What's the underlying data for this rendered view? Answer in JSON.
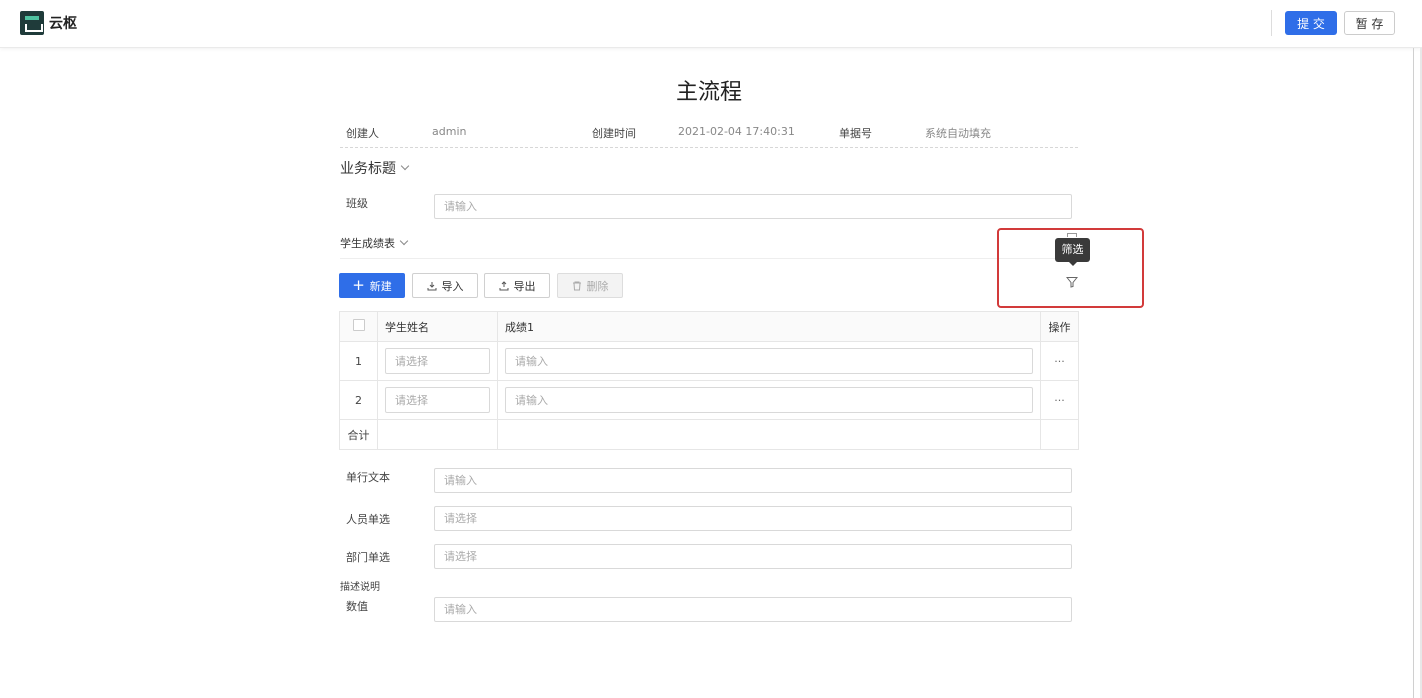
{
  "header": {
    "app_name": "云枢",
    "submit_label": "提 交",
    "draft_label": "暂 存"
  },
  "form": {
    "title": "主流程",
    "meta": {
      "creator_label": "创建人",
      "creator_value": "admin",
      "created_time_label": "创建时间",
      "created_time_value": "2021-02-04 17:40:31",
      "doc_no_label": "单据号",
      "doc_no_value": "系统自动填充"
    },
    "business_title_section": "业务标题",
    "class_field": {
      "label": "班级",
      "placeholder": "请输入"
    },
    "subtable": {
      "title": "学生成绩表",
      "toolbar": {
        "new_label": "新建",
        "import_label": "导入",
        "export_label": "导出",
        "delete_label": "删除"
      },
      "filter_tooltip": "筛选",
      "columns": [
        "学生姓名",
        "成绩1",
        "操作"
      ],
      "rows": [
        {
          "index": "1",
          "name_placeholder": "请选择",
          "score_placeholder": "请输入",
          "more": "···"
        },
        {
          "index": "2",
          "name_placeholder": "请选择",
          "score_placeholder": "请输入",
          "more": "···"
        }
      ],
      "total_label": "合计"
    },
    "fields": [
      {
        "label": "单行文本",
        "placeholder": "请输入"
      },
      {
        "label": "人员单选",
        "placeholder": "请选择"
      },
      {
        "label": "部门单选",
        "placeholder": "请选择"
      },
      {
        "label": "数值",
        "placeholder": "请输入"
      }
    ],
    "description_label": "描述说明"
  },
  "colors": {
    "primary": "#2f6ee8",
    "highlight": "#d23a3a"
  }
}
